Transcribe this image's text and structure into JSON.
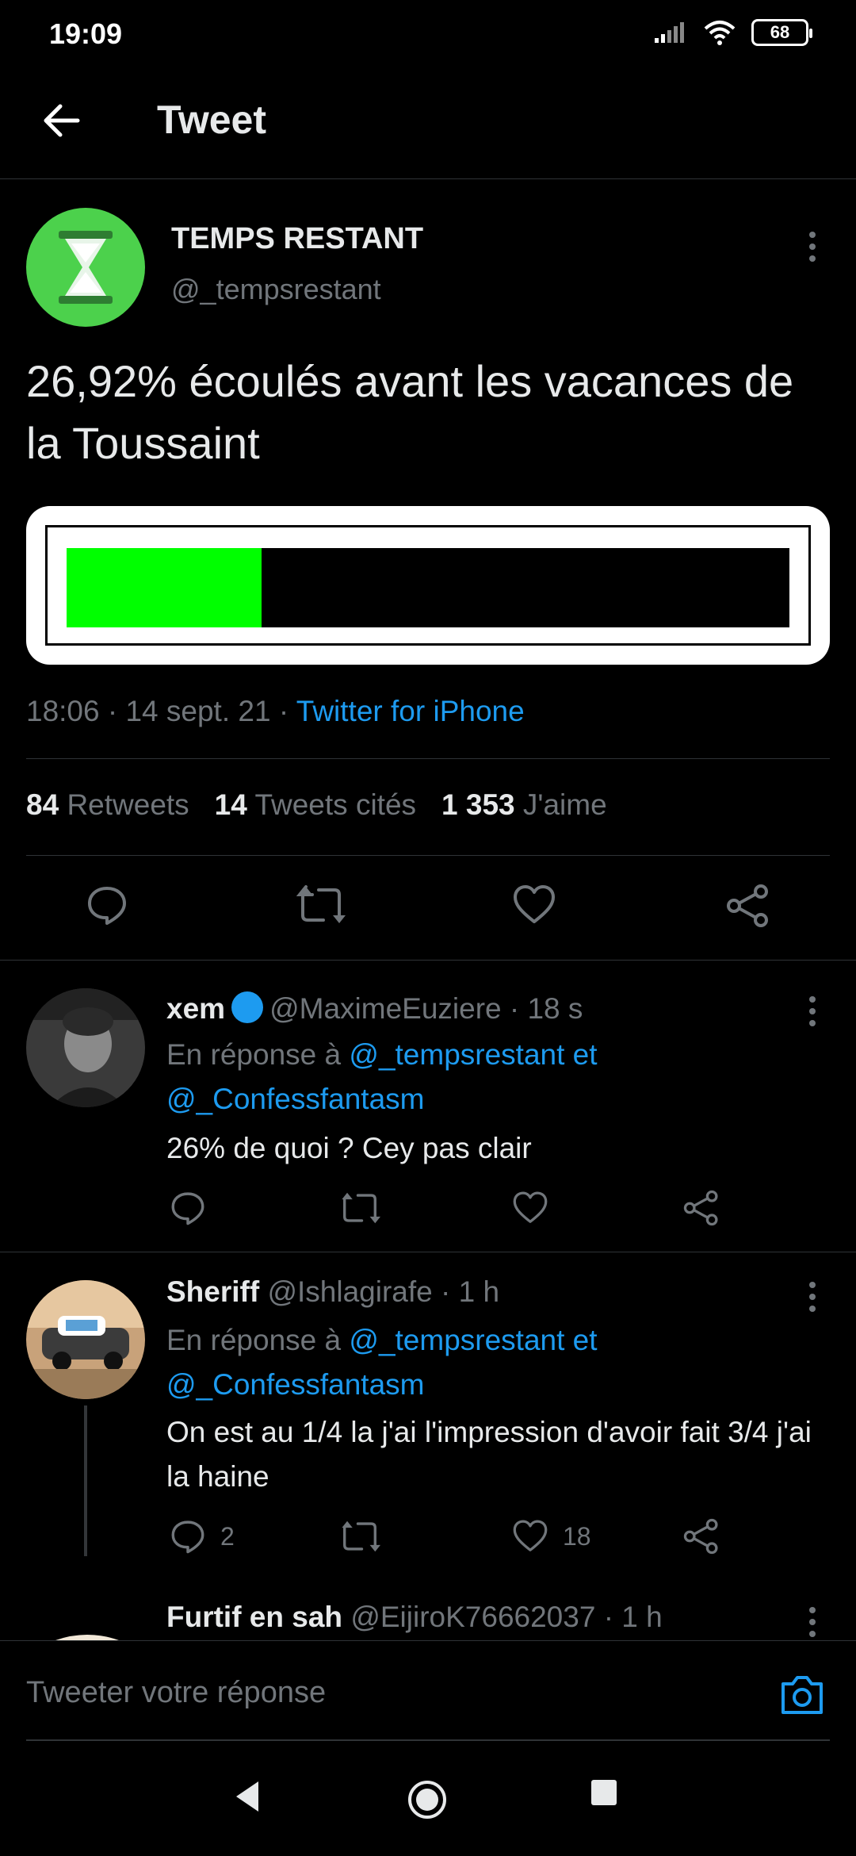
{
  "status_bar": {
    "time": "19:09",
    "battery": "68"
  },
  "header": {
    "title": "Tweet"
  },
  "main_tweet": {
    "author_name": "TEMPS RESTANT",
    "author_handle": "@_tempsrestant",
    "text": "26,92% écoulés avant les vacances de la Toussaint",
    "progress_percent": 26.92,
    "progress_fill_color": "#00ff00",
    "timestamp": "18:06 · 14 sept. 21 · ",
    "source": "Twitter for iPhone",
    "stats": {
      "retweets_count": "84",
      "retweets_label": "Retweets",
      "quotes_count": "14",
      "quotes_label": "Tweets cités",
      "likes_count": "1 353",
      "likes_label": "J'aime"
    }
  },
  "replies": [
    {
      "name": "xem",
      "handle_time": "@MaximeEuziere · 18 s",
      "replying_prefix": "En réponse à ",
      "replying_links": "@_tempsrestant et @_Confessfantasm",
      "text": "26% de quoi ? Cey pas clair",
      "reply_count": "",
      "like_count": ""
    },
    {
      "name": "Sheriff",
      "handle_time": "@Ishlagirafe · 1 h",
      "replying_prefix": "En réponse à ",
      "replying_links": "@_tempsrestant et @_Confessfantasm",
      "text": "On est au 1/4 la j'ai l'impression d'avoir fait 3/4 j'ai la haine",
      "reply_count": "2",
      "like_count": "18"
    },
    {
      "name": "Furtif en sah",
      "handle_time": "@EijiroK76662037 · 1 h"
    }
  ],
  "compose": {
    "placeholder": "Tweeter votre réponse"
  },
  "colors": {
    "accent": "#1d9bf0",
    "background": "#000000",
    "muted": "#71767b"
  }
}
